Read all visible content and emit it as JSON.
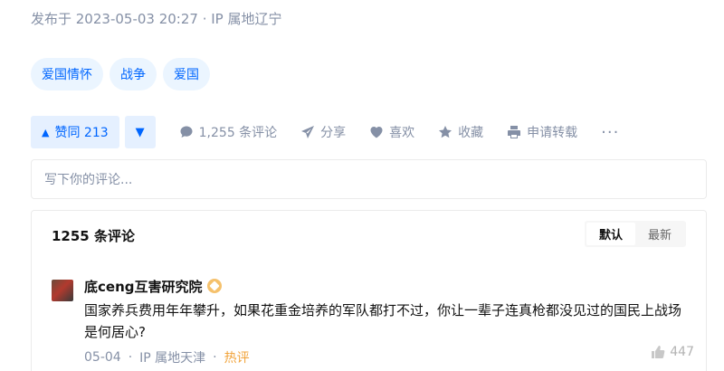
{
  "meta": {
    "text": "发布于 2023-05-03 20:27 · IP 属地辽宁"
  },
  "tags": [
    "爱国情怀",
    "战争",
    "爱国"
  ],
  "actions": {
    "vote_up": "赞同 213",
    "comments": "1,255 条评论",
    "share": "分享",
    "like": "喜欢",
    "collect": "收藏",
    "repost": "申请转载",
    "more": "···"
  },
  "comment_input": {
    "placeholder": "写下你的评论..."
  },
  "comments_panel": {
    "count_label": "1255 条评论",
    "sort_options": [
      "默认",
      "最新"
    ],
    "active_sort": "默认"
  },
  "comment": {
    "author": "底ceng互害研究院",
    "text": "国家养兵费用年年攀升，如果花重金培养的军队都打不过，你让一辈子连真枪都没见过的国民上战场是何居心?",
    "date": "05-04",
    "location": "IP 属地天津",
    "hot_label": "热评",
    "likes": "447"
  },
  "colors": {
    "accent": "#0066ff",
    "muted": "#8590a6",
    "hot": "#f1a33a"
  }
}
